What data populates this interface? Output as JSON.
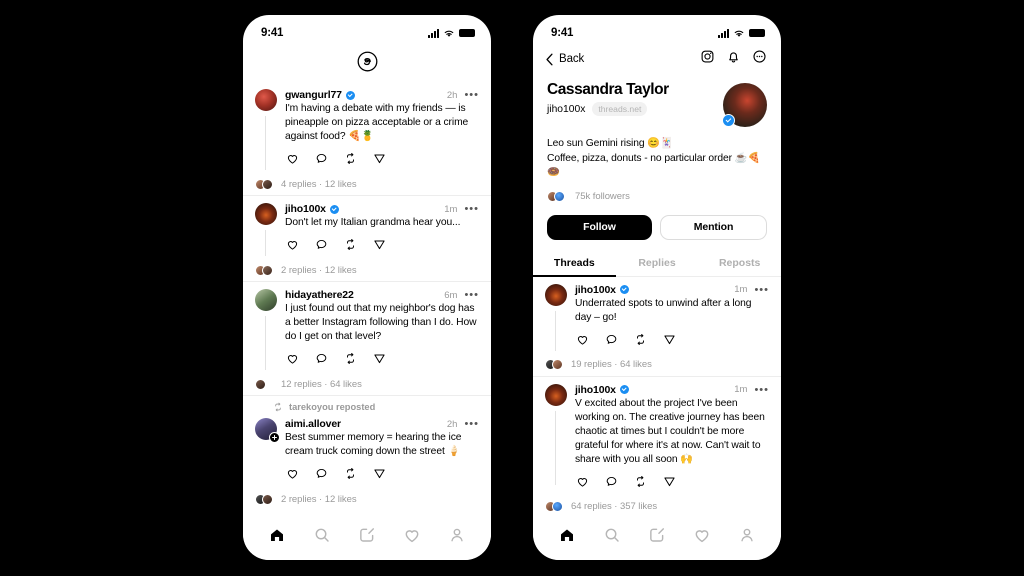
{
  "theme": {
    "background": "#000000",
    "screen_bg": "#ffffff",
    "accent_verified": "#1b8ef2",
    "text_primary": "#000000",
    "text_muted": "#9a9a9a",
    "divider": "#ededed"
  },
  "phone_feed": {
    "status_bar": {
      "time": "9:41",
      "cellular_icon": "signal-bars-icon",
      "wifi_icon": "wifi-icon",
      "battery_icon": "battery-icon"
    },
    "logo": "threads-logo",
    "posts": [
      {
        "username": "gwangurl77",
        "verified": true,
        "timestamp": "2h",
        "more_icon": "more-horizontal-icon",
        "text": "I'm having a debate with my friends — is pineapple on pizza acceptable or a crime against food? 🍕🍍",
        "actions": [
          "like-icon",
          "reply-icon",
          "repost-icon",
          "share-icon"
        ],
        "meta": "4 replies · 12 likes",
        "avatar": "av-gwan",
        "repost_label": null,
        "add_badge": false
      },
      {
        "username": "jiho100x",
        "verified": true,
        "timestamp": "1m",
        "more_icon": "more-horizontal-icon",
        "text": "Don't let my Italian grandma hear you...",
        "actions": [
          "like-icon",
          "reply-icon",
          "repost-icon",
          "share-icon"
        ],
        "meta": "2 replies · 12 likes",
        "avatar": "av-jiho",
        "repost_label": null,
        "add_badge": false
      },
      {
        "username": "hidayathere22",
        "verified": false,
        "timestamp": "6m",
        "more_icon": "more-horizontal-icon",
        "text": "I just found out that my neighbor's dog has a better Instagram following than I do. How do I get on that level?",
        "actions": [
          "like-icon",
          "reply-icon",
          "repost-icon",
          "share-icon"
        ],
        "meta": "12 replies · 64 likes",
        "avatar": "av-hiday",
        "repost_label": null,
        "add_badge": false
      },
      {
        "username": "aimi.allover",
        "verified": false,
        "timestamp": "2h",
        "more_icon": "more-horizontal-icon",
        "text": "Best summer memory = hearing the ice cream truck coming down the street 🍦",
        "actions": [
          "like-icon",
          "reply-icon",
          "repost-icon",
          "share-icon"
        ],
        "meta": "2 replies · 12 likes",
        "avatar": "av-aimi",
        "repost_label": "tarekoyou reposted",
        "add_badge": true
      }
    ],
    "bottom_nav": [
      {
        "name": "home",
        "icon": "home-icon",
        "active": true
      },
      {
        "name": "search",
        "icon": "search-icon",
        "active": false
      },
      {
        "name": "compose",
        "icon": "compose-icon",
        "active": false
      },
      {
        "name": "activity",
        "icon": "heart-icon",
        "active": false
      },
      {
        "name": "profile",
        "icon": "person-icon",
        "active": false
      }
    ]
  },
  "phone_profile": {
    "status_bar": {
      "time": "9:41",
      "cellular_icon": "signal-bars-icon",
      "wifi_icon": "wifi-icon",
      "battery_icon": "battery-icon"
    },
    "topbar": {
      "back_label": "Back",
      "back_icon": "chevron-left-icon",
      "icons": [
        "instagram-icon",
        "bell-icon",
        "more-circle-icon"
      ]
    },
    "profile": {
      "display_name": "Cassandra Taylor",
      "handle": "jiho100x",
      "handle_chip": "threads.net",
      "verified": true,
      "bio_line_1": "Leo sun Gemini rising 😊🃏",
      "bio_line_2": "Coffee, pizza, donuts - no particular order ☕🍕🍩",
      "followers": "75k followers"
    },
    "buttons": {
      "primary": "Follow",
      "secondary": "Mention"
    },
    "tabs": [
      {
        "label": "Threads",
        "active": true
      },
      {
        "label": "Replies",
        "active": false
      },
      {
        "label": "Reposts",
        "active": false
      }
    ],
    "posts": [
      {
        "username": "jiho100x",
        "verified": true,
        "timestamp": "1m",
        "more_icon": "more-horizontal-icon",
        "text": "Underrated spots to unwind after a long day – go!",
        "actions": [
          "like-icon",
          "reply-icon",
          "repost-icon",
          "share-icon"
        ],
        "meta": "19 replies · 64 likes",
        "avatar": "av-jiho"
      },
      {
        "username": "jiho100x",
        "verified": true,
        "timestamp": "1m",
        "more_icon": "more-horizontal-icon",
        "text": "V excited about the project I've been working on. The creative journey has been chaotic at times but I couldn't be more grateful for where it's at now. Can't wait to share with you all soon 🙌",
        "actions": [
          "like-icon",
          "reply-icon",
          "repost-icon",
          "share-icon"
        ],
        "meta": "64 replies · 357 likes",
        "avatar": "av-jiho"
      }
    ],
    "bottom_nav": [
      {
        "name": "home",
        "icon": "home-icon",
        "active": true
      },
      {
        "name": "search",
        "icon": "search-icon",
        "active": false
      },
      {
        "name": "compose",
        "icon": "compose-icon",
        "active": false
      },
      {
        "name": "activity",
        "icon": "heart-icon",
        "active": false
      },
      {
        "name": "profile",
        "icon": "person-icon",
        "active": false
      }
    ]
  }
}
